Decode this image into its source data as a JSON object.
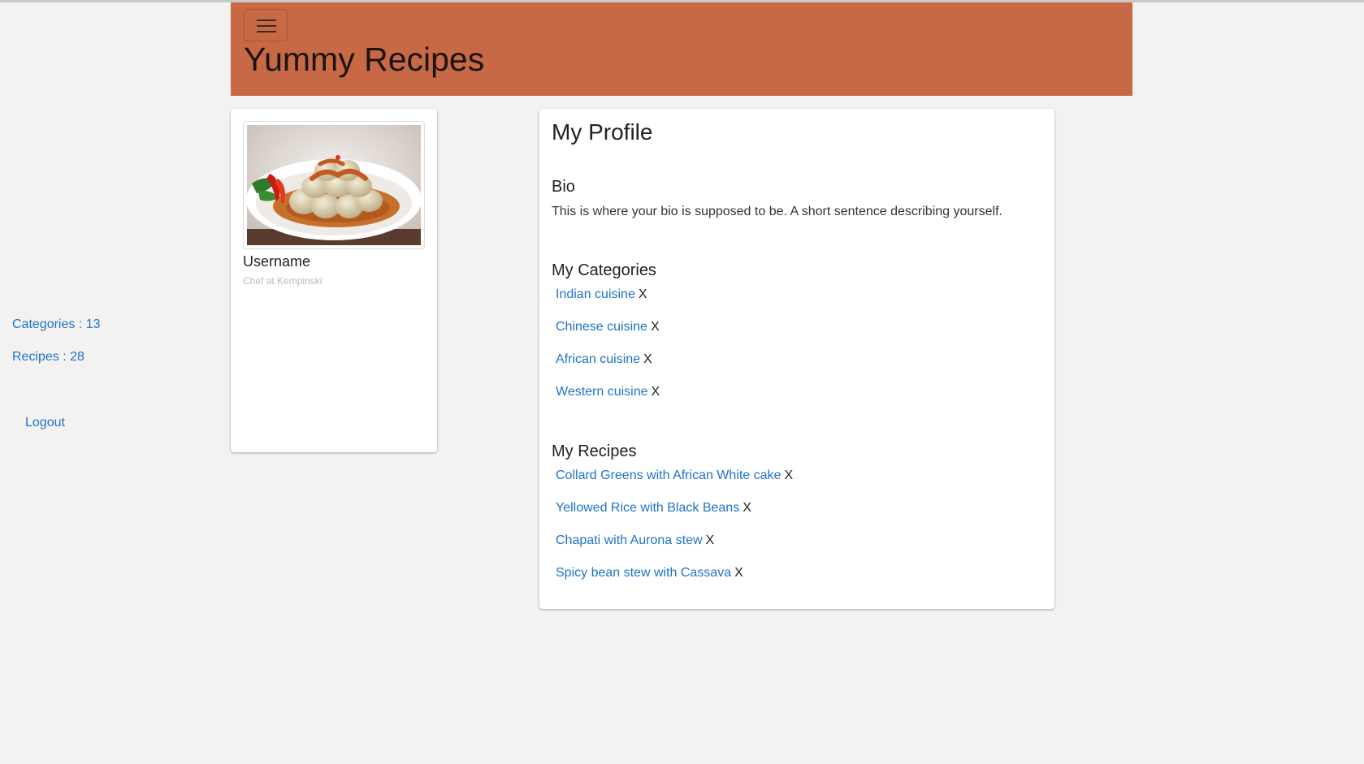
{
  "app": {
    "title": "Yummy Recipes"
  },
  "header": {
    "menu_icon": "hamburger-menu-icon"
  },
  "profile_card": {
    "username": "Username",
    "role": "Chef at Kempinski",
    "categories_stat": "Categories : 13",
    "recipes_stat": "Recipes : 28",
    "logout_label": "Logout"
  },
  "main": {
    "title": "My Profile",
    "bio": {
      "heading": "Bio",
      "text": "This is where your bio is supposed to be. A short sentence describing yourself."
    },
    "categories": {
      "heading": "My Categories",
      "items": [
        {
          "label": "Indian cuisine",
          "remove": "X"
        },
        {
          "label": "Chinese cuisine",
          "remove": "X"
        },
        {
          "label": "African cuisine",
          "remove": "X"
        },
        {
          "label": "Western cuisine",
          "remove": "X"
        }
      ]
    },
    "recipes": {
      "heading": "My Recipes",
      "items": [
        {
          "label": "Collard Greens with African White cake",
          "remove": "X"
        },
        {
          "label": "Yellowed Rice with Black Beans",
          "remove": "X"
        },
        {
          "label": "Chapati with Aurona stew",
          "remove": "X"
        },
        {
          "label": "Spicy bean stew with Cassava",
          "remove": "X"
        }
      ]
    }
  },
  "colors": {
    "header_bg": "#c76945",
    "page_bg": "#f3f2f0",
    "link": "#1e73c8"
  }
}
